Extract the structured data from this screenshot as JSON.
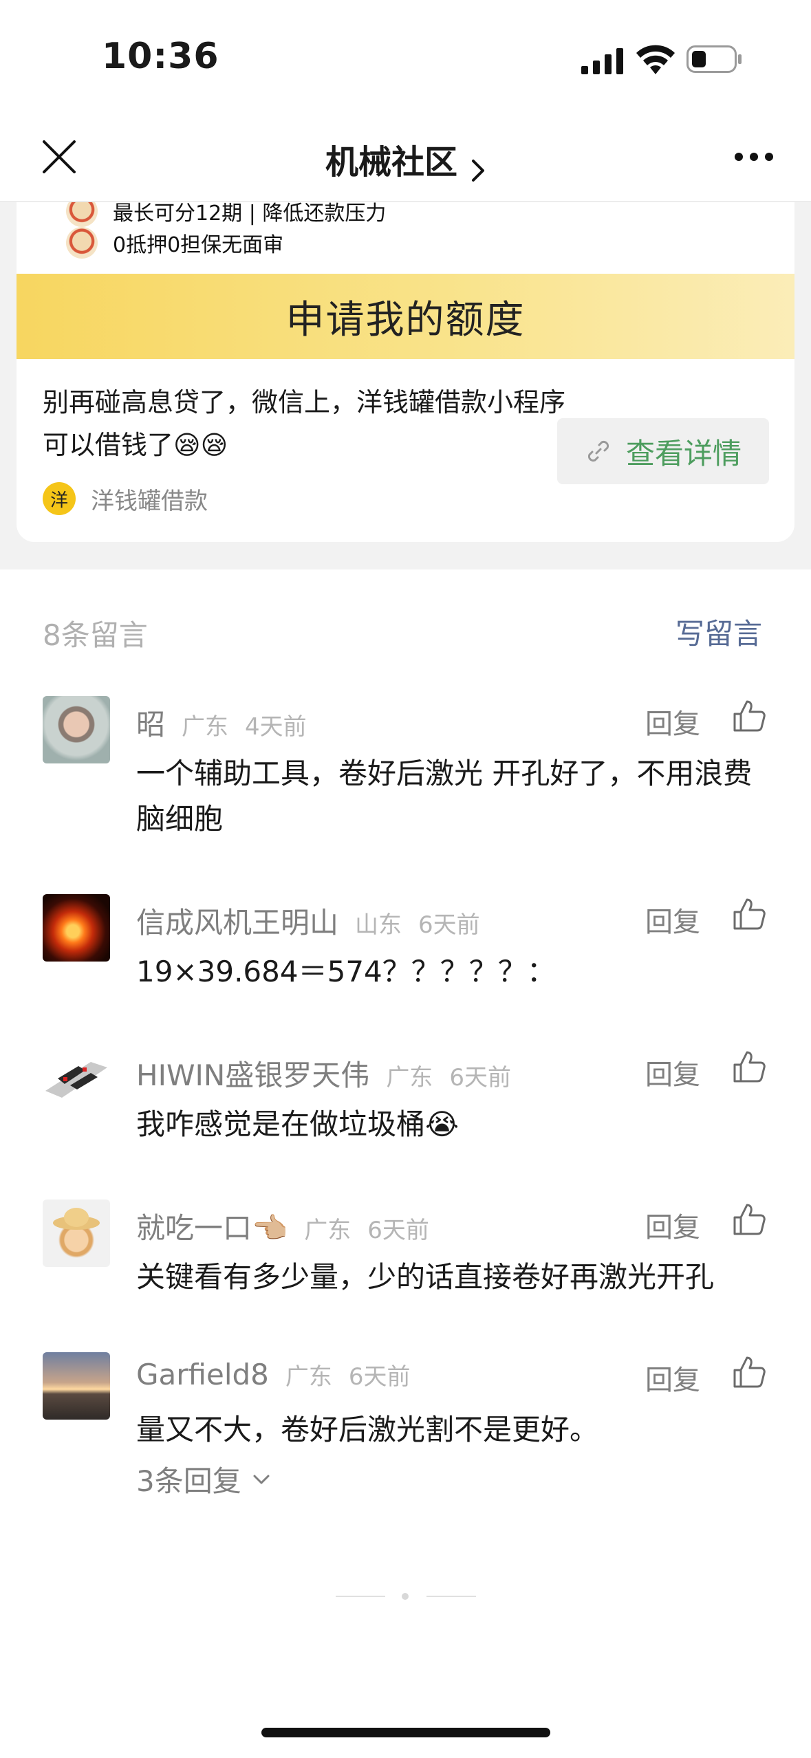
{
  "status_bar": {
    "time": "10:36",
    "signal_icon": "cellular-signal-icon",
    "wifi_icon": "wifi-icon",
    "battery_icon": "battery-low-icon"
  },
  "nav": {
    "title": "机械社区",
    "close_icon": "close-icon",
    "more_icon": "more-dots-icon"
  },
  "ad": {
    "feature_1": "最长可分12期 | 降低还款压力",
    "feature_2": "0抵押0担保无面审",
    "banner_text": "申请我的额度",
    "body_text": "别再碰高息贷了，微信上，洋钱罐借款小程序可以借钱了😪😪",
    "button_label": "查看详情",
    "source_logo_text": "洋",
    "source_name": "洋钱罐借款",
    "banner_color": "#f7d660",
    "button_text_color": "#4d9d5e"
  },
  "comments_header": {
    "count_label": "8条留言",
    "write_label": "写留言",
    "write_color": "#576b95"
  },
  "comments": [
    {
      "name": "昭",
      "location": "广东",
      "time": "4天前",
      "reply_label": "回复",
      "text": "一个辅助工具，卷好后激光 开孔好了，不用浪费脑细胞",
      "avatar": "child-photo-avatar"
    },
    {
      "name": "信成风机王明山",
      "location": "山东",
      "time": "6天前",
      "reply_label": "回复",
      "text": "19×39.684＝574？？？？？：",
      "avatar": "fire-horse-avatar"
    },
    {
      "name": "HIWIN盛银罗天伟",
      "location": "广东",
      "time": "6天前",
      "reply_label": "回复",
      "text": "我咋感觉是在做垃圾桶😭",
      "avatar": "linear-guide-avatar"
    },
    {
      "name": "就吃一口👈🏼",
      "location": "广东",
      "time": "6天前",
      "reply_label": "回复",
      "text": "关键看有多少量，少的话直接卷好再激光开孔",
      "avatar": "cartoon-explorer-avatar"
    },
    {
      "name": "Garfield8",
      "location": "广东",
      "time": "6天前",
      "reply_label": "回复",
      "text": "量又不大，卷好后激光割不是更好。",
      "avatar": "sunset-avatar",
      "replies_label": "3条回复"
    }
  ]
}
